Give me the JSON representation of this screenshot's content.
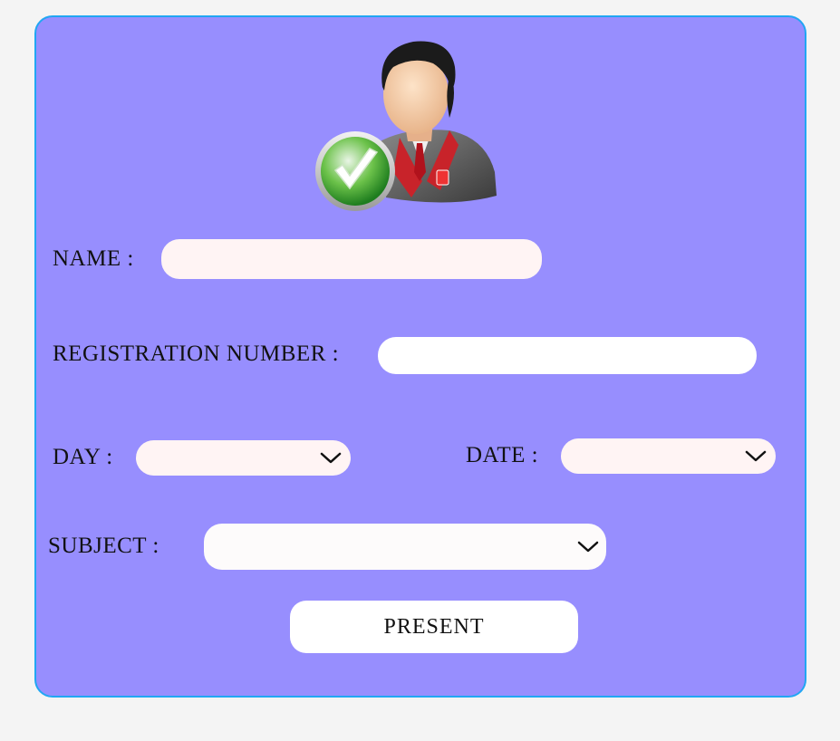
{
  "form": {
    "avatar_icon": "user-checked-icon",
    "name_label": "NAME :",
    "name_value": "",
    "registration_label": "REGISTRATION NUMBER :",
    "registration_value": "",
    "day_label": "DAY :",
    "day_value": "",
    "date_label": "DATE :",
    "date_value": "",
    "subject_label": "SUBJECT :",
    "subject_value": "",
    "submit_label": "PRESENT"
  },
  "colors": {
    "page_background": "#f4f4f4",
    "card_background": "#978efe",
    "card_border": "#21a6f3",
    "field_pink": "#fff4f4",
    "field_white": "#ffffff"
  }
}
